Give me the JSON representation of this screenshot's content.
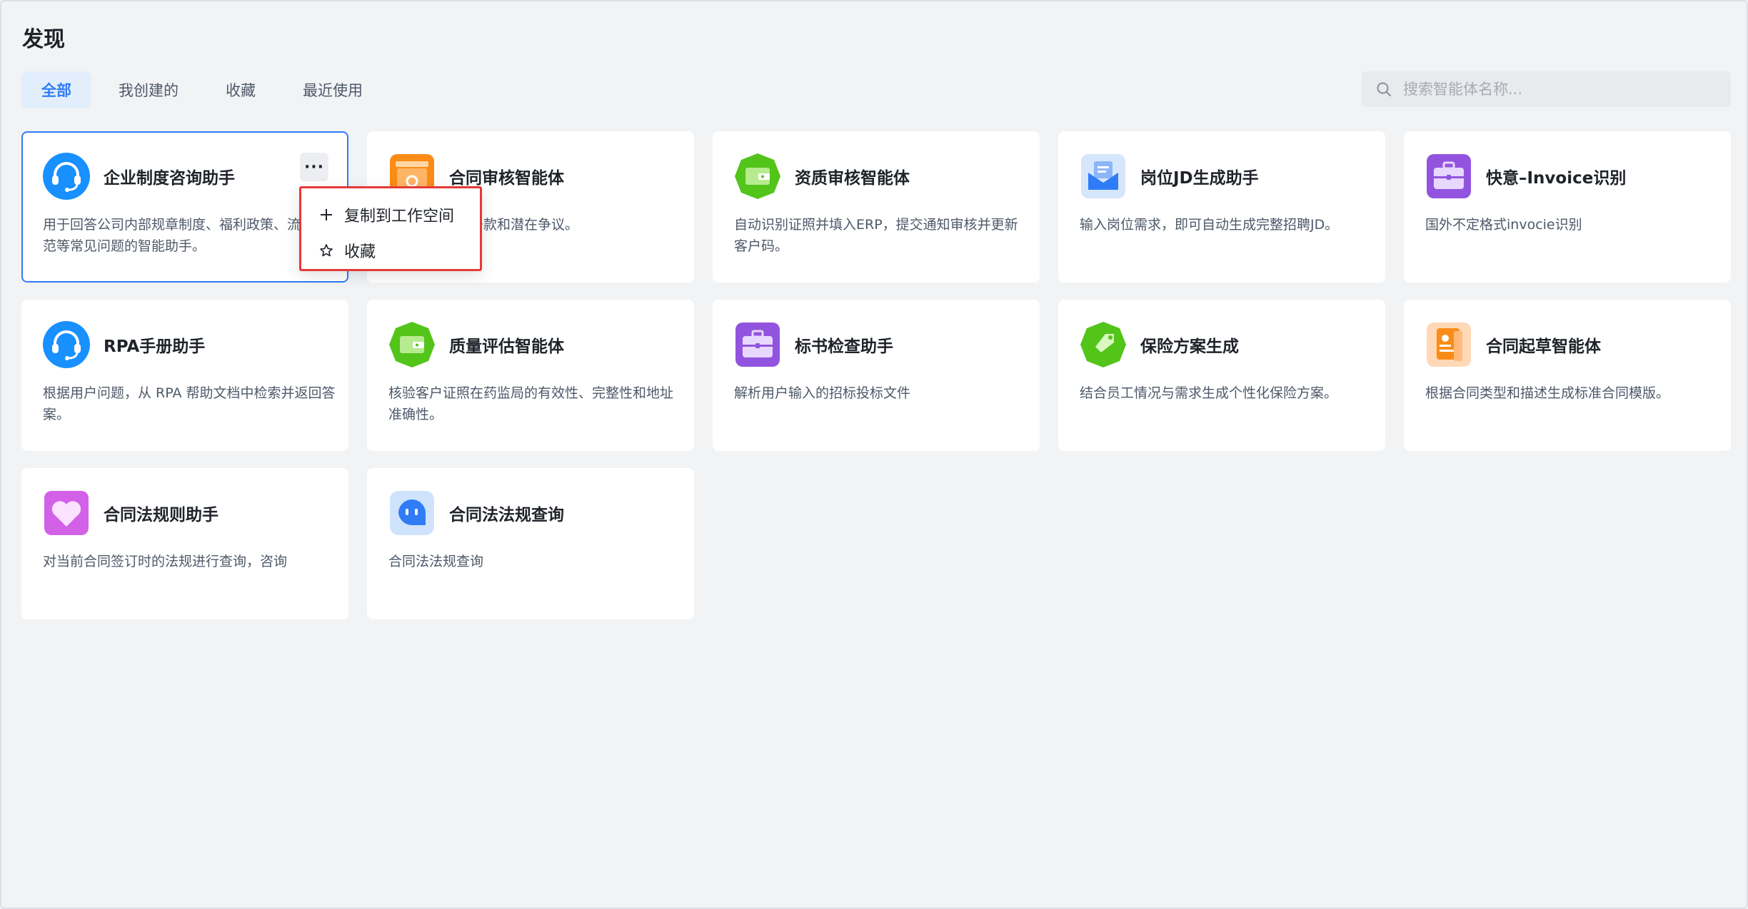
{
  "page": {
    "title": "发现"
  },
  "tabs": [
    {
      "label": "全部",
      "active": true
    },
    {
      "label": "我创建的",
      "active": false
    },
    {
      "label": "收藏",
      "active": false
    },
    {
      "label": "最近使用",
      "active": false
    }
  ],
  "search": {
    "placeholder": "搜索智能体名称..."
  },
  "cards": [
    {
      "name": "企业制度咨询助手",
      "desc": "用于回答公司内部规章制度、福利政策、流程规范等常见问题的智能助手。",
      "icon": "headset-icon",
      "color": "#1890ff"
    },
    {
      "name": "合同审核智能体",
      "desc": "智能识别缺失条款和潜在争议。",
      "icon": "contract-icon",
      "color": "#fa8c16"
    },
    {
      "name": "资质审核智能体",
      "desc": "自动识别证照并填入ERP，提交通知审核并更新客户码。",
      "icon": "wallet-icon",
      "color": "#52c41a"
    },
    {
      "name": "岗位JD生成助手",
      "desc": "输入岗位需求，即可自动生成完整招聘JD。",
      "icon": "mail-icon",
      "color": "#2f7cf6"
    },
    {
      "name": "快意–Invoice识别",
      "desc": "国外不定格式invocie识别",
      "icon": "briefcase-icon",
      "color": "#9254de"
    },
    {
      "name": "RPA手册助手",
      "desc": "根据用户问题，从 RPA 帮助文档中检索并返回答案。",
      "icon": "headset-icon",
      "color": "#1890ff"
    },
    {
      "name": "质量评估智能体",
      "desc": "核验客户证照在药监局的有效性、完整性和地址准确性。",
      "icon": "wallet-icon",
      "color": "#52c41a"
    },
    {
      "name": "标书检查助手",
      "desc": "解析用户输入的招标投标文件",
      "icon": "briefcase-icon",
      "color": "#9254de"
    },
    {
      "name": "保险方案生成",
      "desc": "结合员工情况与需求生成个性化保险方案。",
      "icon": "tag-icon",
      "color": "#52c41a"
    },
    {
      "name": "合同起草智能体",
      "desc": "根据合同类型和描述生成标准合同模版。",
      "icon": "document-person-icon",
      "color": "#fa8c16"
    },
    {
      "name": "合同法规则助手",
      "desc": "对当前合同签订时的法规进行查询，咨询",
      "icon": "heart-icon",
      "color": "#d361e8"
    },
    {
      "name": "合同法法规查询",
      "desc": "合同法法规查询",
      "icon": "robot-icon",
      "color": "#2f7cf6"
    }
  ],
  "context_menu": {
    "items": [
      {
        "label": "复制到工作空间",
        "icon": "plus-icon"
      },
      {
        "label": "收藏",
        "icon": "star-icon"
      }
    ]
  }
}
